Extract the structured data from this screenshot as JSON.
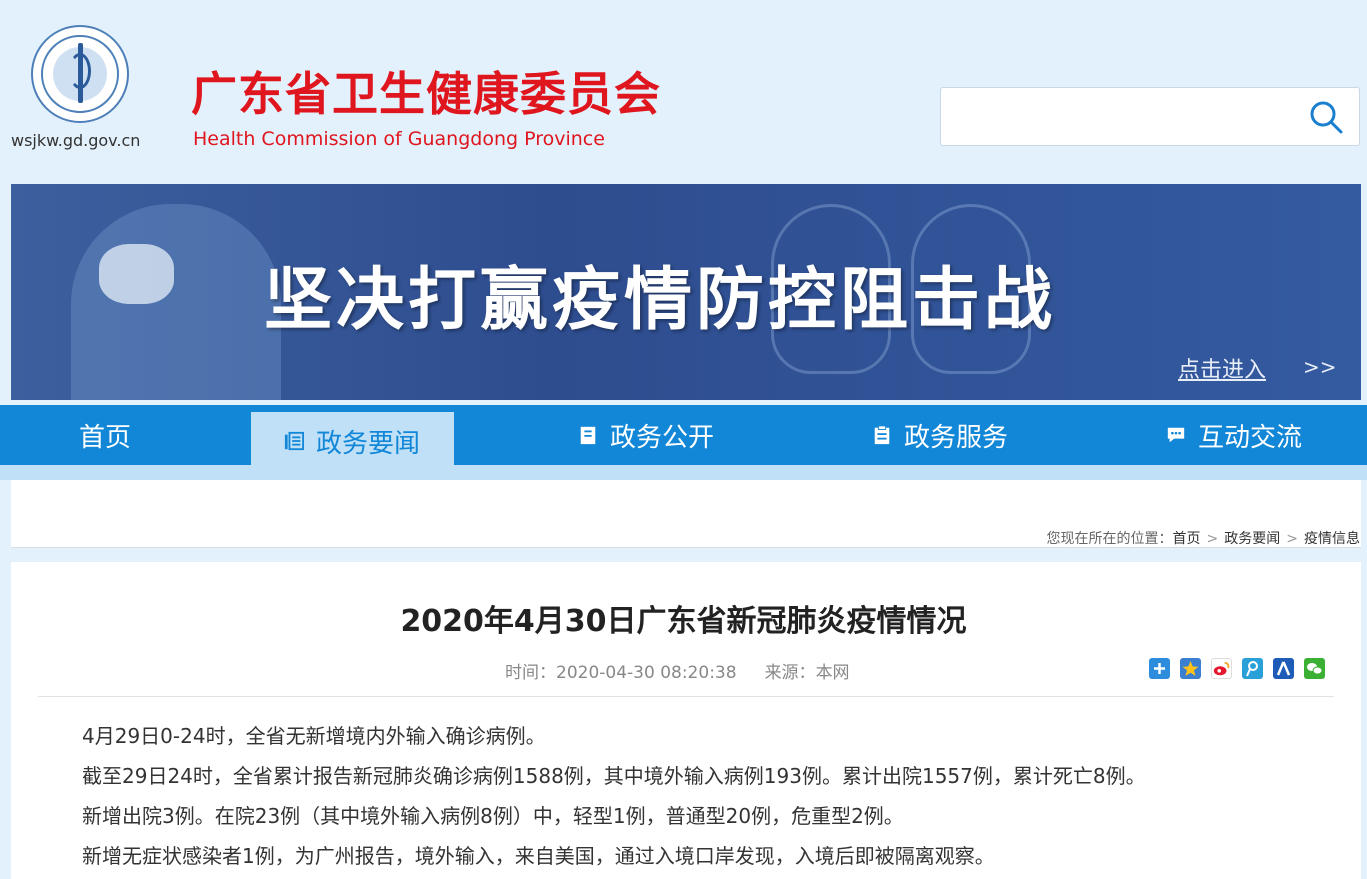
{
  "header": {
    "domain": "wsjkw.gd.gov.cn",
    "title": "广东省卫生健康委员会",
    "subtitle": "Health Commission of Guangdong Province",
    "search": {
      "placeholder": "",
      "icon": "search-icon"
    }
  },
  "banner": {
    "title": "坚决打赢疫情防控阻击战",
    "link": "点击进入",
    "arrow": ">>"
  },
  "nav": {
    "items": [
      {
        "label": "首页",
        "icon": ""
      },
      {
        "label": "政务要闻",
        "icon": "news-icon",
        "active": true
      },
      {
        "label": "政务公开",
        "icon": "document-icon"
      },
      {
        "label": "政务服务",
        "icon": "clipboard-icon"
      },
      {
        "label": "互动交流",
        "icon": "chat-icon"
      }
    ]
  },
  "breadcrumb": {
    "prefix": "您现在所在的位置：",
    "items": [
      "首页",
      "政务要闻",
      "疫情信息"
    ],
    "separator": ">"
  },
  "article": {
    "title": "2020年4月30日广东省新冠肺炎疫情情况",
    "time_label": "时间：",
    "time": "2020-04-30 08:20:38",
    "source_label": "来源：",
    "source": "本网",
    "share_icons": [
      "share-more-icon",
      "qzone-icon",
      "weibo-icon",
      "tencent-weibo-icon",
      "renren-icon",
      "wechat-icon"
    ],
    "paragraphs": [
      "4月29日0-24时，全省无新增境内外输入确诊病例。",
      "截至29日24时，全省累计报告新冠肺炎确诊病例1588例，其中境外输入病例193例。累计出院1557例，累计死亡8例。",
      "新增出院3例。在院23例（其中境外输入病例8例）中，轻型1例，普通型20例，危重型2例。",
      "新增无症状感染者1例，为广州报告，境外输入，来自美国，通过入境口岸发现，入境后即被隔离观察。"
    ]
  },
  "colors": {
    "title_red": "#e0161e",
    "nav_blue": "#1287d8",
    "nav_active_bg": "#bfe0f7",
    "banner_blue": "#2e4d8f"
  }
}
